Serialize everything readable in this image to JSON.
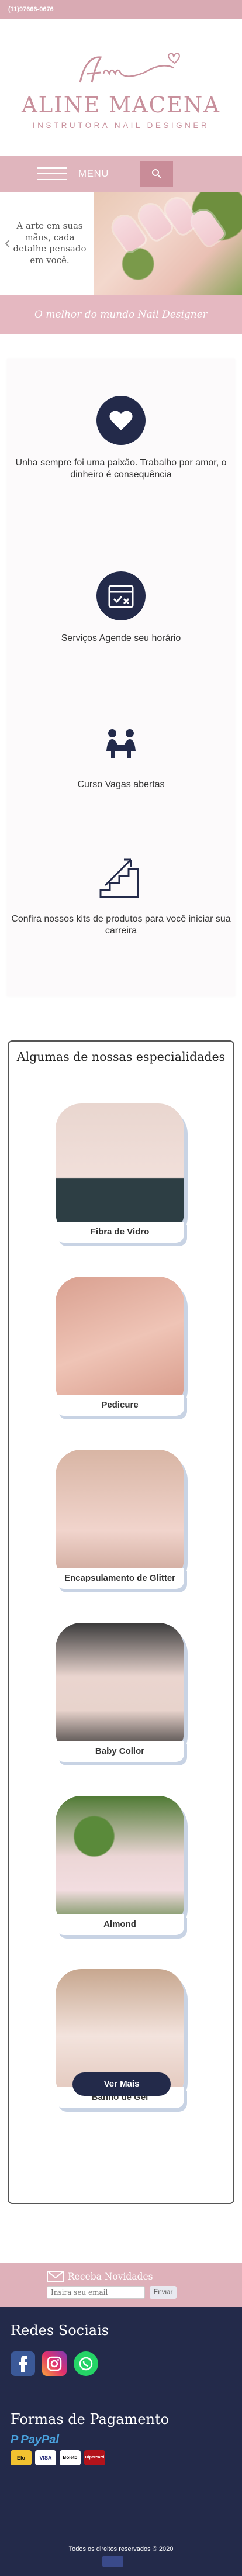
{
  "topbar": {
    "phone": "(11)97666-0676"
  },
  "logo": {
    "monogram": "Am",
    "name": "ALINE MACENA",
    "subtitle": "INSTRUTORA NAIL DESIGNER"
  },
  "nav": {
    "menu_label": "MENU"
  },
  "hero": {
    "text": "A arte em suas mãos, cada detalhe pensado em você."
  },
  "banner": {
    "text": "O melhor do mundo Nail Designer"
  },
  "features": [
    {
      "icon": "heart-icon",
      "text": "Unha sempre foi uma paixão. Trabalho por amor, o dinheiro é consequência"
    },
    {
      "icon": "calendar-icon",
      "text": "Serviços Agende seu horário"
    },
    {
      "icon": "course-icon",
      "text": "Curso Vagas abertas"
    },
    {
      "icon": "stairs-icon",
      "text": "Confira nossos kits de produtos para você iniciar sua carreira"
    }
  ],
  "specialties": {
    "title": "Algumas de nossas especialidades",
    "items": [
      {
        "label": "Fibra de Vidro"
      },
      {
        "label": "Pedicure"
      },
      {
        "label": "Encapsulamento de Glitter"
      },
      {
        "label": "Baby Collor"
      },
      {
        "label": "Almond"
      },
      {
        "label": "Banho de Gel"
      }
    ],
    "button": "Ver Mais"
  },
  "newsletter": {
    "label": "Receba Novidades",
    "placeholder": "Insira seu email",
    "button": "Enviar"
  },
  "footer": {
    "social_title": "Redes Sociais",
    "payment_title": "Formas de Pagamento",
    "paypal": "PayPal",
    "cards": [
      "Elo",
      "VISA",
      "Boleto",
      "Hipercard"
    ],
    "copyright": "Todos os direitos reservados © 2020"
  },
  "colors": {
    "accent_pink": "#e0b5bd",
    "navy": "#232a4a",
    "logo_pink": "#c8909c"
  }
}
